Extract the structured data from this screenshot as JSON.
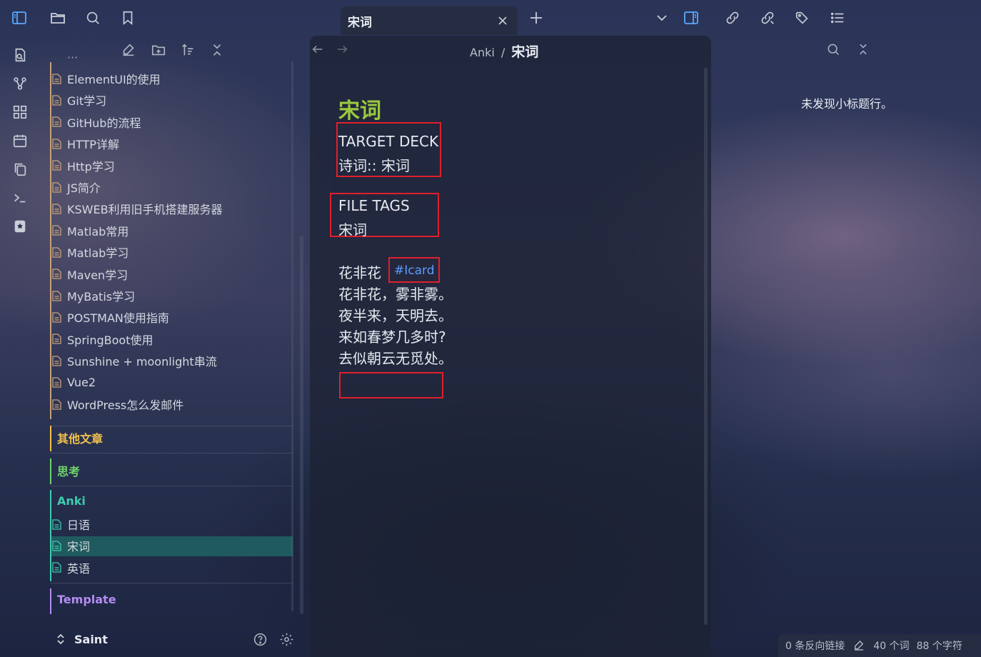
{
  "tab": {
    "title": "宋词"
  },
  "breadcrumb": {
    "parent": "Anki",
    "separator": "/",
    "current": "宋词"
  },
  "sidebar": {
    "partial_item": "···",
    "files": [
      "ElementUI的使用",
      "Git学习",
      "GitHub的流程",
      "HTTP详解",
      "Http学习",
      "JS简介",
      "KSWEB利用旧手机搭建服务器",
      "Matlab常用",
      "Matlab学习",
      "Maven学习",
      "MyBatis学习",
      "POSTMAN使用指南",
      "SpringBoot使用",
      "Sunshine + moonlight串流",
      "Vue2",
      "WordPress怎么发邮件"
    ],
    "folders": {
      "other": {
        "label": "其他文章",
        "color": "#f2c14e"
      },
      "thinking": {
        "label": "思考",
        "color": "#6fd36b"
      },
      "anki": {
        "label": "Anki",
        "color": "#3ecbb0",
        "items": [
          "日语",
          "宋词",
          "英语"
        ],
        "active": "宋词"
      },
      "template": {
        "label": "Template",
        "color": "#b48cf2"
      }
    },
    "vault_name": "Saint"
  },
  "note": {
    "title": "宋词",
    "deck_label": "TARGET DECK",
    "deck_value": "诗词:: 宋词",
    "tags_label": "FILE TAGS",
    "tags_value": "宋词",
    "card_front": "花非花",
    "card_tag": "#Icard",
    "poem": [
      "花非花，雾非雾。",
      "夜半来，天明去。",
      "来如春梦几多时?",
      "去似朝云无觅处。"
    ]
  },
  "outline": {
    "empty_message": "未发现小标题行。"
  },
  "status": {
    "backlinks": "0 条反向链接",
    "words": "40 个词",
    "chars": "88 个字符"
  },
  "colors": {
    "title_green": "#9ac93e",
    "highlight_red": "#e01f2c",
    "tag_blue": "#5d9bff",
    "active_row": "#1f5a5e"
  }
}
